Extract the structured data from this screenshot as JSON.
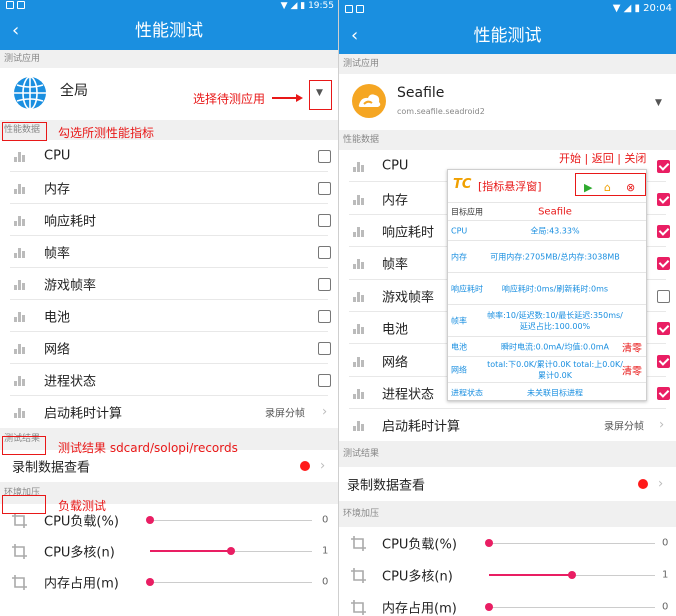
{
  "left": {
    "status_time": "19:55",
    "title": "性能测试",
    "section_app": "测试应用",
    "app_name": "全局",
    "section_perf": "性能数据",
    "items": [
      {
        "label": "CPU"
      },
      {
        "label": "内存"
      },
      {
        "label": "响应耗时"
      },
      {
        "label": "帧率"
      },
      {
        "label": "游戏帧率"
      },
      {
        "label": "电池"
      },
      {
        "label": "网络"
      },
      {
        "label": "进程状态"
      }
    ],
    "startup": {
      "label": "启动耗时计算",
      "value": "录屏分帧"
    },
    "section_result": "测试结果",
    "record_label": "录制数据查看",
    "section_env": "环境加压",
    "sliders": [
      {
        "label": "CPU负载(%)",
        "value": "0",
        "fraction": 0.0
      },
      {
        "label": "CPU多核(n)",
        "value": "1",
        "fraction": 0.5
      },
      {
        "label": "内存占用(m)",
        "value": "0",
        "fraction": 0.0
      }
    ],
    "annotations": {
      "select_app": "选择待测应用",
      "check_metrics": "勾选所测性能指标",
      "result_path": "测试结果 sdcard/solopi/records",
      "load_test": "负载测试"
    }
  },
  "right": {
    "status_time": "20:04",
    "title": "性能测试",
    "section_app": "测试应用",
    "app_name": "Seafile",
    "app_package": "com.seafile.seadroid2",
    "section_perf": "性能数据",
    "items": [
      {
        "label": "CPU",
        "checked": true
      },
      {
        "label": "内存",
        "checked": true
      },
      {
        "label": "响应耗时",
        "checked": true
      },
      {
        "label": "帧率",
        "checked": true
      },
      {
        "label": "游戏帧率",
        "checked": false
      },
      {
        "label": "电池",
        "checked": true
      },
      {
        "label": "网络",
        "checked": true
      },
      {
        "label": "进程状态",
        "checked": true
      }
    ],
    "startup": {
      "label": "启动耗时计算",
      "value": "录屏分帧"
    },
    "section_result": "测试结果",
    "record_label": "录制数据查看",
    "section_env": "环境加压",
    "sliders": [
      {
        "label": "CPU负载(%)",
        "value": "0",
        "fraction": 0.0
      },
      {
        "label": "CPU多核(n)",
        "value": "1",
        "fraction": 0.5
      },
      {
        "label": "内存占用(m)",
        "value": "0",
        "fraction": 0.0
      }
    ],
    "annotation_controls": "开始 | 返回 | 关闭",
    "float": {
      "title": "[指标悬浮窗]",
      "target_key": "目标应用",
      "target_value": "Seafile",
      "rows": [
        {
          "key": "CPU",
          "value": "全局:43.33%"
        },
        {
          "key": "内存",
          "value": "可用内存:2705MB/总内存:3038MB"
        },
        {
          "key": "响应耗时",
          "value": "响应耗时:0ms/刷新耗时:0ms"
        },
        {
          "key": "帧率",
          "value": "帧率:10/延迟数:10/最长延迟:350ms/延迟占比:100.00%"
        },
        {
          "key": "电池",
          "value": "瞬时电流:0.0mA/均值:0.0mA",
          "clear": "清零"
        },
        {
          "key": "网络",
          "value": "total:下0.0K/累计0.0K total:上0.0K/累计0.0K",
          "clear": "清零"
        },
        {
          "key": "进程状态",
          "value": "未关联目标进程"
        }
      ]
    }
  },
  "colors": {
    "primary": "#1a8fe0",
    "accent": "#e91e63",
    "annotation": "#e81818"
  }
}
